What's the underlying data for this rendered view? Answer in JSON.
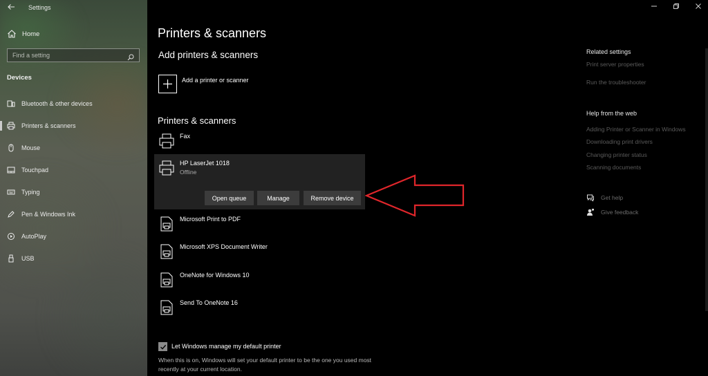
{
  "app": {
    "title": "Settings"
  },
  "sidebar": {
    "home_label": "Home",
    "search_placeholder": "Find a setting",
    "section_label": "Devices",
    "items": [
      {
        "label": "Bluetooth & other devices",
        "icon": "bluetooth-devices-icon"
      },
      {
        "label": "Printers & scanners",
        "icon": "printer-icon",
        "active": true
      },
      {
        "label": "Mouse",
        "icon": "mouse-icon"
      },
      {
        "label": "Touchpad",
        "icon": "touchpad-icon"
      },
      {
        "label": "Typing",
        "icon": "keyboard-icon"
      },
      {
        "label": "Pen & Windows Ink",
        "icon": "pen-icon"
      },
      {
        "label": "AutoPlay",
        "icon": "autoplay-icon"
      },
      {
        "label": "USB",
        "icon": "usb-icon"
      }
    ]
  },
  "main": {
    "page_title": "Printers & scanners",
    "add_section_title": "Add printers & scanners",
    "add_label": "Add a printer or scanner",
    "list_title": "Printers & scanners",
    "devices": [
      {
        "name": "Fax",
        "status": ""
      },
      {
        "name": "HP LaserJet 1018",
        "status": "Offline",
        "selected": true
      },
      {
        "name": "Microsoft Print to PDF",
        "status": ""
      },
      {
        "name": "Microsoft XPS Document Writer",
        "status": ""
      },
      {
        "name": "OneNote for Windows 10",
        "status": ""
      },
      {
        "name": "Send To OneNote 16",
        "status": ""
      }
    ],
    "actions": {
      "open_queue": "Open queue",
      "manage": "Manage",
      "remove_device": "Remove device"
    },
    "default_printer": {
      "label": "Let Windows manage my default printer",
      "checked": true,
      "description": "When this is on, Windows will set your default printer to be the one you used most recently at your current location."
    }
  },
  "related": {
    "title": "Related settings",
    "links": [
      "Print server properties",
      "Run the troubleshooter"
    ]
  },
  "help": {
    "title": "Help from the web",
    "links": [
      "Adding Printer or Scanner in Windows",
      "Downloading print drivers",
      "Changing printer status",
      "Scanning documents"
    ]
  },
  "support": {
    "get_help": "Get help",
    "give_feedback": "Give feedback"
  },
  "colors": {
    "annotation_arrow": "#e0262b",
    "selected_card": "#222222",
    "button_bg": "#3c3c3c"
  }
}
